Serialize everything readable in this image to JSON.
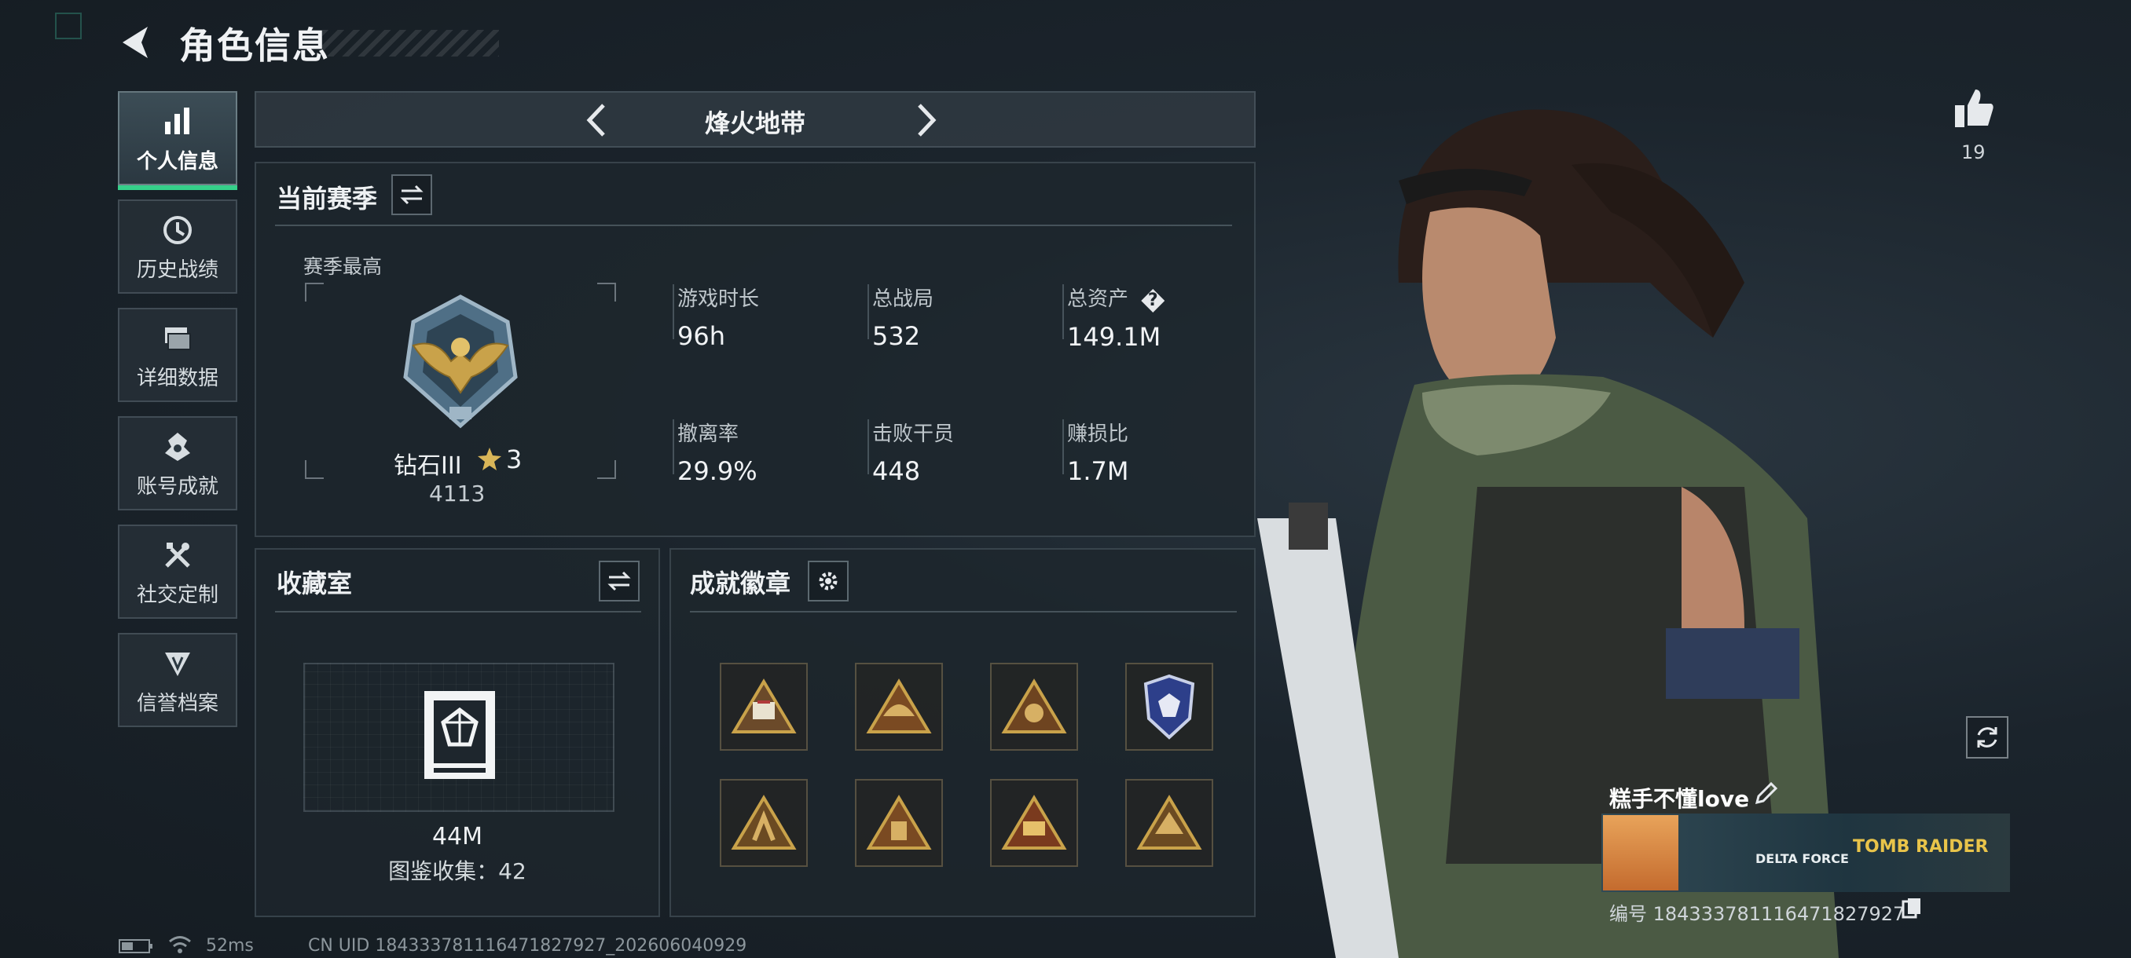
{
  "header": {
    "title": "角色信息"
  },
  "sidebar": {
    "items": [
      {
        "label": "个人信息",
        "active": true,
        "icon": "bar-chart-icon"
      },
      {
        "label": "历史战绩",
        "active": false,
        "icon": "history-clock-icon"
      },
      {
        "label": "详细数据",
        "active": false,
        "icon": "folder-icon"
      },
      {
        "label": "账号成就",
        "active": false,
        "icon": "achievement-icon"
      },
      {
        "label": "社交定制",
        "active": false,
        "icon": "tools-icon"
      },
      {
        "label": "信誉档案",
        "active": false,
        "icon": "credit-shield-icon"
      }
    ]
  },
  "mode": {
    "name": "烽火地带"
  },
  "season": {
    "title": "当前赛季",
    "best_label": "赛季最高",
    "rank_name": "钻石III",
    "rank_stars": "3",
    "rank_score": "4113",
    "stats": [
      {
        "label": "游戏时长",
        "value": "96h"
      },
      {
        "label": "总战局",
        "value": "532"
      },
      {
        "label": "总资产",
        "value": "149.1M",
        "help": "?"
      },
      {
        "label": "撤离率",
        "value": "29.9%"
      },
      {
        "label": "击败干员",
        "value": "448"
      },
      {
        "label": "赚损比",
        "value": "1.7M"
      }
    ]
  },
  "collection": {
    "title": "收藏室",
    "value": "44M",
    "count_text": "图鉴收集：42"
  },
  "badges": {
    "title": "成就徽章",
    "count": 8
  },
  "likes": {
    "count": "19"
  },
  "profile": {
    "name": "糕手不懂love",
    "id_text": "编号 184333781116471827927",
    "banner_text1": "DELTA FORCE",
    "banner_text2": "TOMB RAIDER"
  },
  "status": {
    "ping": "52ms",
    "uid": "CN UID 184333781116471827927_202606040929"
  },
  "colors": {
    "accent": "#35d08a",
    "gold": "#c9a24a",
    "panel": "#1e262d"
  }
}
